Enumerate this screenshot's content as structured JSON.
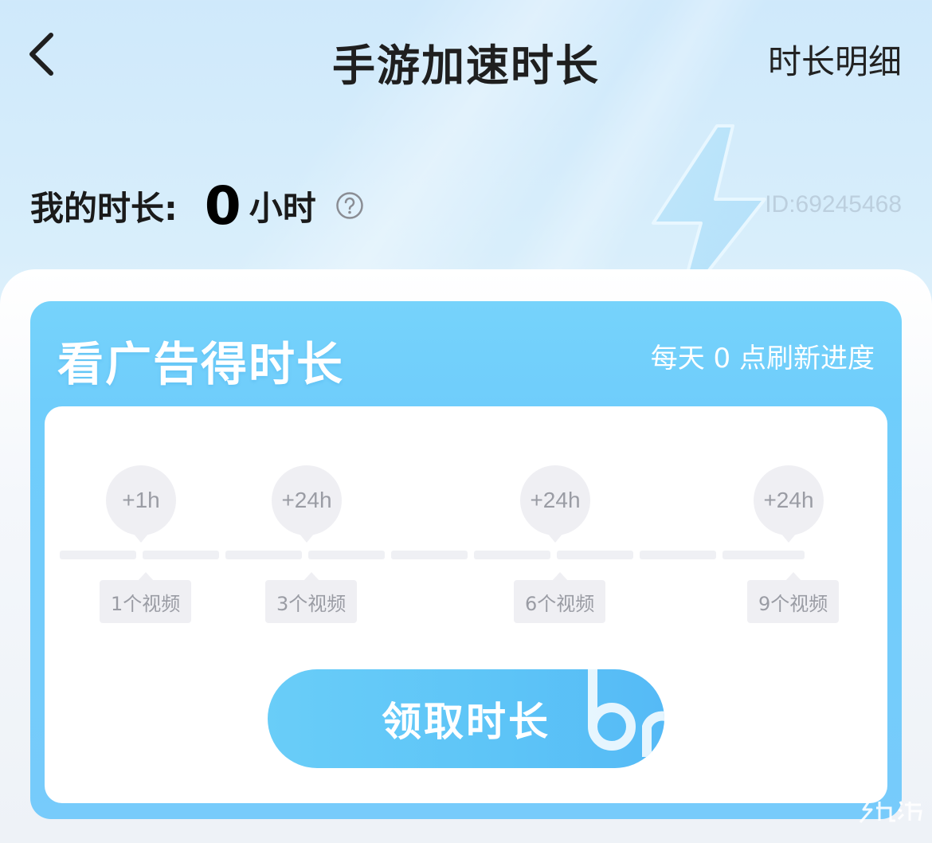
{
  "header": {
    "title": "手游加速时长",
    "detail_link": "时长明细"
  },
  "summary": {
    "label": "我的时长:",
    "value": "0",
    "unit": "小时",
    "user_id": "ID:69245468"
  },
  "task_card": {
    "title": "看广告得时长",
    "refresh_note": "每天 0 点刷新进度",
    "milestones": [
      {
        "reward": "+1h",
        "requirement": "1个视频"
      },
      {
        "reward": "+24h",
        "requirement": "3个视频"
      },
      {
        "reward": "+24h",
        "requirement": "6个视频"
      },
      {
        "reward": "+24h",
        "requirement": "9个视频"
      }
    ],
    "progress_segments_total": 9,
    "progress_segments_done": 0,
    "claim_button": "领取时长"
  },
  "colors": {
    "accent": "#6fcdfb",
    "button": "#5dc4f7",
    "muted": "#9a9ca4"
  }
}
